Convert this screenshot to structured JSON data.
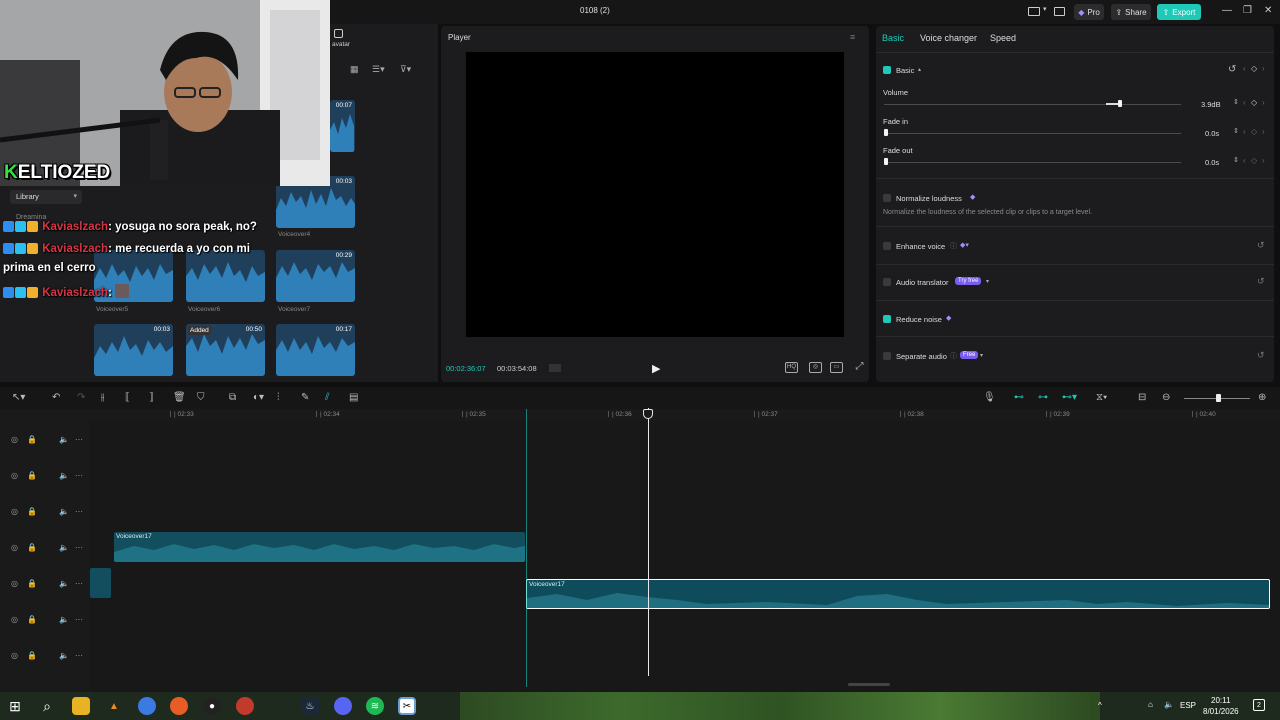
{
  "window": {
    "title": "0108 (2)",
    "pro_label": "Pro",
    "share_label": "Share",
    "export_label": "Export"
  },
  "colors": {
    "accent": "#1ec9b7",
    "clip": "#124e5e",
    "pro": "#7a5df0",
    "chat_user": "#d63545",
    "brand_k": "#33e244"
  },
  "media": {
    "avatar_label": "avatar",
    "library_label": "Library",
    "folder_label": "Dreamina",
    "clips": [
      {
        "name": "",
        "duration": "00:07",
        "added": ""
      },
      {
        "name": "Voiceover4",
        "duration": "00:03",
        "added": ""
      },
      {
        "name": "Voiceover5",
        "duration": "",
        "added": ""
      },
      {
        "name": "Voiceover6",
        "duration": "",
        "added": ""
      },
      {
        "name": "Voiceover7",
        "duration": "00:29",
        "added": ""
      },
      {
        "name": "",
        "duration": "00:03",
        "added": ""
      },
      {
        "name": "",
        "duration": "00:50",
        "added": "Added"
      },
      {
        "name": "",
        "duration": "00:17",
        "added": ""
      }
    ]
  },
  "stream": {
    "brand_k": "K",
    "brand_rest": "ELTIOZED",
    "chat": [
      {
        "user": "Kaviaslzach",
        "text": ": yosuga no sora peak, no?"
      },
      {
        "user": "Kaviaslzach",
        "text": ": me recuerda a yo con mi",
        "cont": "prima en el cerro"
      },
      {
        "user": "Kaviaslzach",
        "text": ":"
      }
    ]
  },
  "player": {
    "title": "Player",
    "current_time": "00:02:36:07",
    "total_time": "00:03:54:08"
  },
  "props": {
    "tabs": [
      "Basic",
      "Voice changer",
      "Speed"
    ],
    "basic_label": "Basic",
    "volume": {
      "label": "Volume",
      "value": "3.9dB",
      "level": 0.78
    },
    "fade_in": {
      "label": "Fade in",
      "value": "0.0s"
    },
    "fade_out": {
      "label": "Fade out",
      "value": "0.0s"
    },
    "normalize": {
      "label": "Normalize loudness",
      "desc": "Normalize the loudness of the selected clip or clips to a target level."
    },
    "enhance": {
      "label": "Enhance voice"
    },
    "translator": {
      "label": "Audio translator",
      "badge": "Try free"
    },
    "noise": {
      "label": "Reduce noise"
    },
    "separate": {
      "label": "Separate audio",
      "badge": "Free"
    }
  },
  "timeline": {
    "ticks": [
      "| 02:33",
      "| 02:34",
      "| 02:35",
      "| 02:36",
      "| 02:37",
      "| 02:38",
      "| 02:39",
      "| 02:40"
    ],
    "clips": [
      {
        "label": "Voiceover17"
      },
      {
        "label": "Voiceover17"
      }
    ]
  },
  "taskbar": {
    "lang": "ESP",
    "time": "20:11",
    "date": "8/01/2026",
    "notif": "2"
  }
}
